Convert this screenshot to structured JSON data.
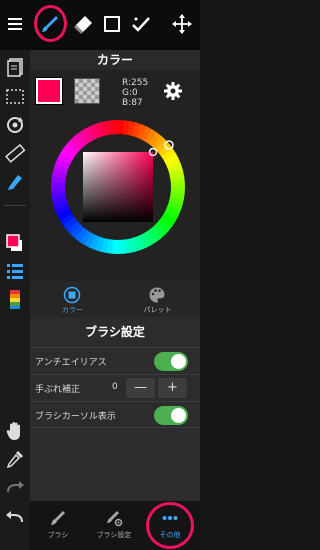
{
  "toolbar": {
    "icons": [
      "menu-icon",
      "brush-icon",
      "eraser-icon",
      "selection-icon",
      "check-icon",
      "move-icon"
    ]
  },
  "left_rail": {
    "icons": [
      "layers-icon",
      "select-area-icon",
      "rotate-icon",
      "ruler-icon",
      "pen-tool-icon",
      "color-swatch-icon",
      "list-icon",
      "stripe-palette-icon",
      "hand-icon",
      "eyedropper-icon",
      "redo-icon",
      "undo-icon"
    ]
  },
  "color_panel": {
    "title": "カラー",
    "rgb": {
      "r": "R:255",
      "g": "G:0",
      "b": "B:87"
    },
    "current_color": "#ff0057",
    "tabs": {
      "color": "カラー",
      "palette": "パレット"
    }
  },
  "brush_settings": {
    "title": "ブラシ設定",
    "antialias": {
      "label": "アンチエイリアス",
      "on": true
    },
    "stabilizer": {
      "label": "手ぶれ補正",
      "value": "0",
      "minus": "—",
      "plus": "+"
    },
    "brush_cursor": {
      "label": "ブラシカーソル表示",
      "on": true
    }
  },
  "bottom_tabs": {
    "brush": "ブラシ",
    "brush_settings": "ブラシ設定",
    "other": "その他"
  },
  "colors": {
    "accent": "#39a7ff",
    "highlight": "#ec1262",
    "toggle_on": "#4caf50"
  }
}
